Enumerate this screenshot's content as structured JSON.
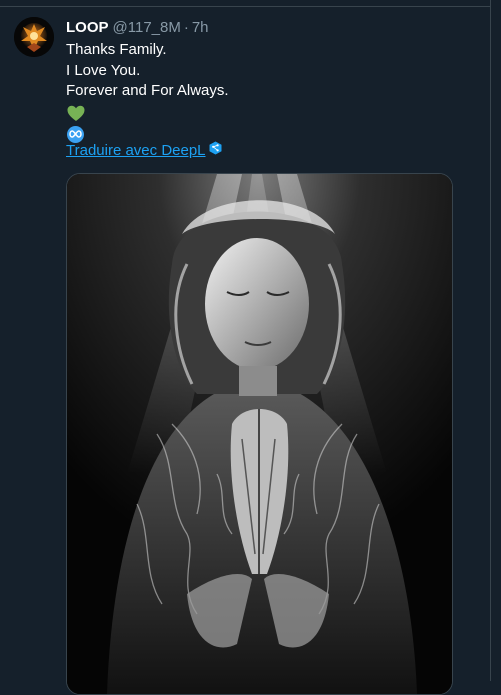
{
  "tweet": {
    "author_name": "LOOP",
    "handle": "@117_8M",
    "separator": "·",
    "time": "7h",
    "lines": [
      "Thanks Family.",
      "I Love You.",
      "Forever and For Always."
    ],
    "emojis": [
      "green-heart",
      "infinity"
    ],
    "translate_label": "Traduire avec DeepL"
  },
  "colors": {
    "background": "#15202b",
    "link": "#1da1f2",
    "muted": "#8899a6"
  }
}
